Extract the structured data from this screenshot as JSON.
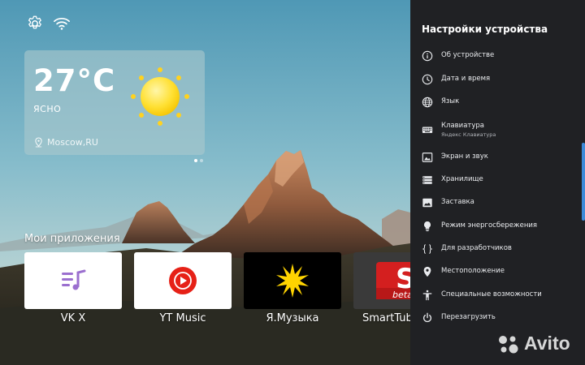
{
  "status_bar": {
    "settings_icon": "gear-icon",
    "network_icon": "wifi-icon"
  },
  "weather": {
    "temperature": "27°C",
    "condition": "ЯСНО",
    "location": "Moscow,RU",
    "icon": "sun-icon",
    "page_count": 2,
    "active_page": 1
  },
  "apps": {
    "heading": "Мои приложения",
    "items": [
      {
        "label": "VK X",
        "icon": "vk-music-icon"
      },
      {
        "label": "YT Music",
        "icon": "youtube-music-icon"
      },
      {
        "label": "Я.Музыка",
        "icon": "yandex-music-icon"
      },
      {
        "label": "SmartTub",
        "icon": "smarttube-icon",
        "tile_text": "S",
        "tile_subtext": "beta"
      }
    ]
  },
  "settings_panel": {
    "title": "Настройки устройства",
    "items": [
      {
        "label": "Об устройстве",
        "icon": "info-icon"
      },
      {
        "label": "Дата и время",
        "icon": "clock-icon"
      },
      {
        "label": "Язык",
        "icon": "globe-icon"
      },
      {
        "label": "Клавиатура",
        "sublabel": "Яндекс Клавиатура",
        "icon": "keyboard-icon"
      },
      {
        "label": "Экран и звук",
        "icon": "display-icon"
      },
      {
        "label": "Хранилище",
        "icon": "storage-icon"
      },
      {
        "label": "Заставка",
        "icon": "screensaver-icon"
      },
      {
        "label": "Режим энергосбережения",
        "icon": "lightbulb-icon"
      },
      {
        "label": "Для разработчиков",
        "icon": "braces-icon"
      },
      {
        "label": "Местоположение",
        "icon": "location-icon"
      },
      {
        "label": "Специальные возможности",
        "icon": "accessibility-icon"
      },
      {
        "label": "Перезагрузить",
        "icon": "power-icon"
      }
    ]
  },
  "watermark": {
    "text": "Avito",
    "icon": "avito-logo"
  },
  "colors": {
    "panel_background": "#202124",
    "accent": "#3d8bd9",
    "youtube_red": "#e62117",
    "vk_purple": "#9b6fcf",
    "yandex_yellow": "#ffd400"
  }
}
